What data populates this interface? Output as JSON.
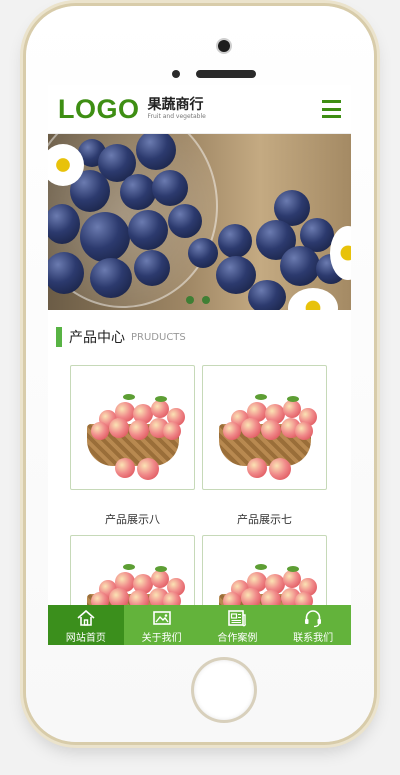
{
  "header": {
    "logo": "LOGO",
    "brand_cn": "果蔬商行",
    "brand_en": "Fruit and vegetable",
    "menu_icon": "hamburger-menu-icon"
  },
  "banner": {
    "dots": 2
  },
  "section": {
    "title_cn": "产品中心",
    "title_en": "PRUDUCTS"
  },
  "products": [
    {
      "name": "产品展示八"
    },
    {
      "name": "产品展示七"
    },
    {
      "name": ""
    },
    {
      "name": ""
    }
  ],
  "nav": {
    "items": [
      {
        "label": "网站首页",
        "icon": "home-icon",
        "active": true
      },
      {
        "label": "关于我们",
        "icon": "image-icon",
        "active": false
      },
      {
        "label": "合作案例",
        "icon": "newspaper-icon",
        "active": false
      },
      {
        "label": "联系我们",
        "icon": "headset-icon",
        "active": false
      }
    ]
  },
  "colors": {
    "brand_green": "#3e8e13",
    "nav_green": "#63b33b",
    "nav_active": "#3b8f1c",
    "accent_bar": "#58b344"
  }
}
